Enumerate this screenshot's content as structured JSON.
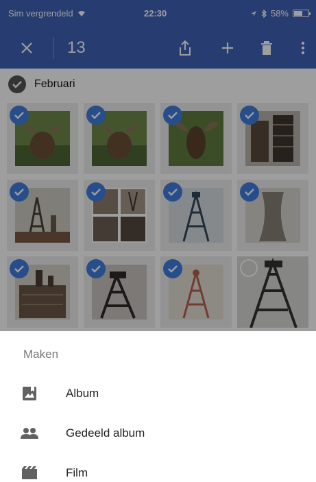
{
  "status_bar": {
    "carrier": "Sim vergrendeld",
    "time": "22:30",
    "battery": "58%",
    "battery_level": 0.58
  },
  "app_bar": {
    "selected_count": "13"
  },
  "content": {
    "section_label": "Februari",
    "tiles": [
      {
        "selected": true,
        "photo": "moose"
      },
      {
        "selected": true,
        "photo": "moose"
      },
      {
        "selected": true,
        "photo": "moose-front"
      },
      {
        "selected": true,
        "photo": "industrial"
      },
      {
        "selected": true,
        "photo": "headframe"
      },
      {
        "selected": true,
        "photo": "collage"
      },
      {
        "selected": true,
        "photo": "headframe-blue"
      },
      {
        "selected": true,
        "photo": "cooling-tower"
      },
      {
        "selected": true,
        "photo": "factory"
      },
      {
        "selected": true,
        "photo": "headframe-dark"
      },
      {
        "selected": true,
        "photo": "headframe-red"
      },
      {
        "selected": false,
        "photo": "headframe-steel"
      }
    ]
  },
  "sheet": {
    "title": "Maken",
    "items": [
      {
        "label": "Album",
        "icon": "album-icon"
      },
      {
        "label": "Gedeeld album",
        "icon": "shared-album-icon"
      },
      {
        "label": "Film",
        "icon": "film-icon"
      }
    ]
  },
  "colors": {
    "primary": "#3f61b5",
    "check": "#3f7de0"
  }
}
